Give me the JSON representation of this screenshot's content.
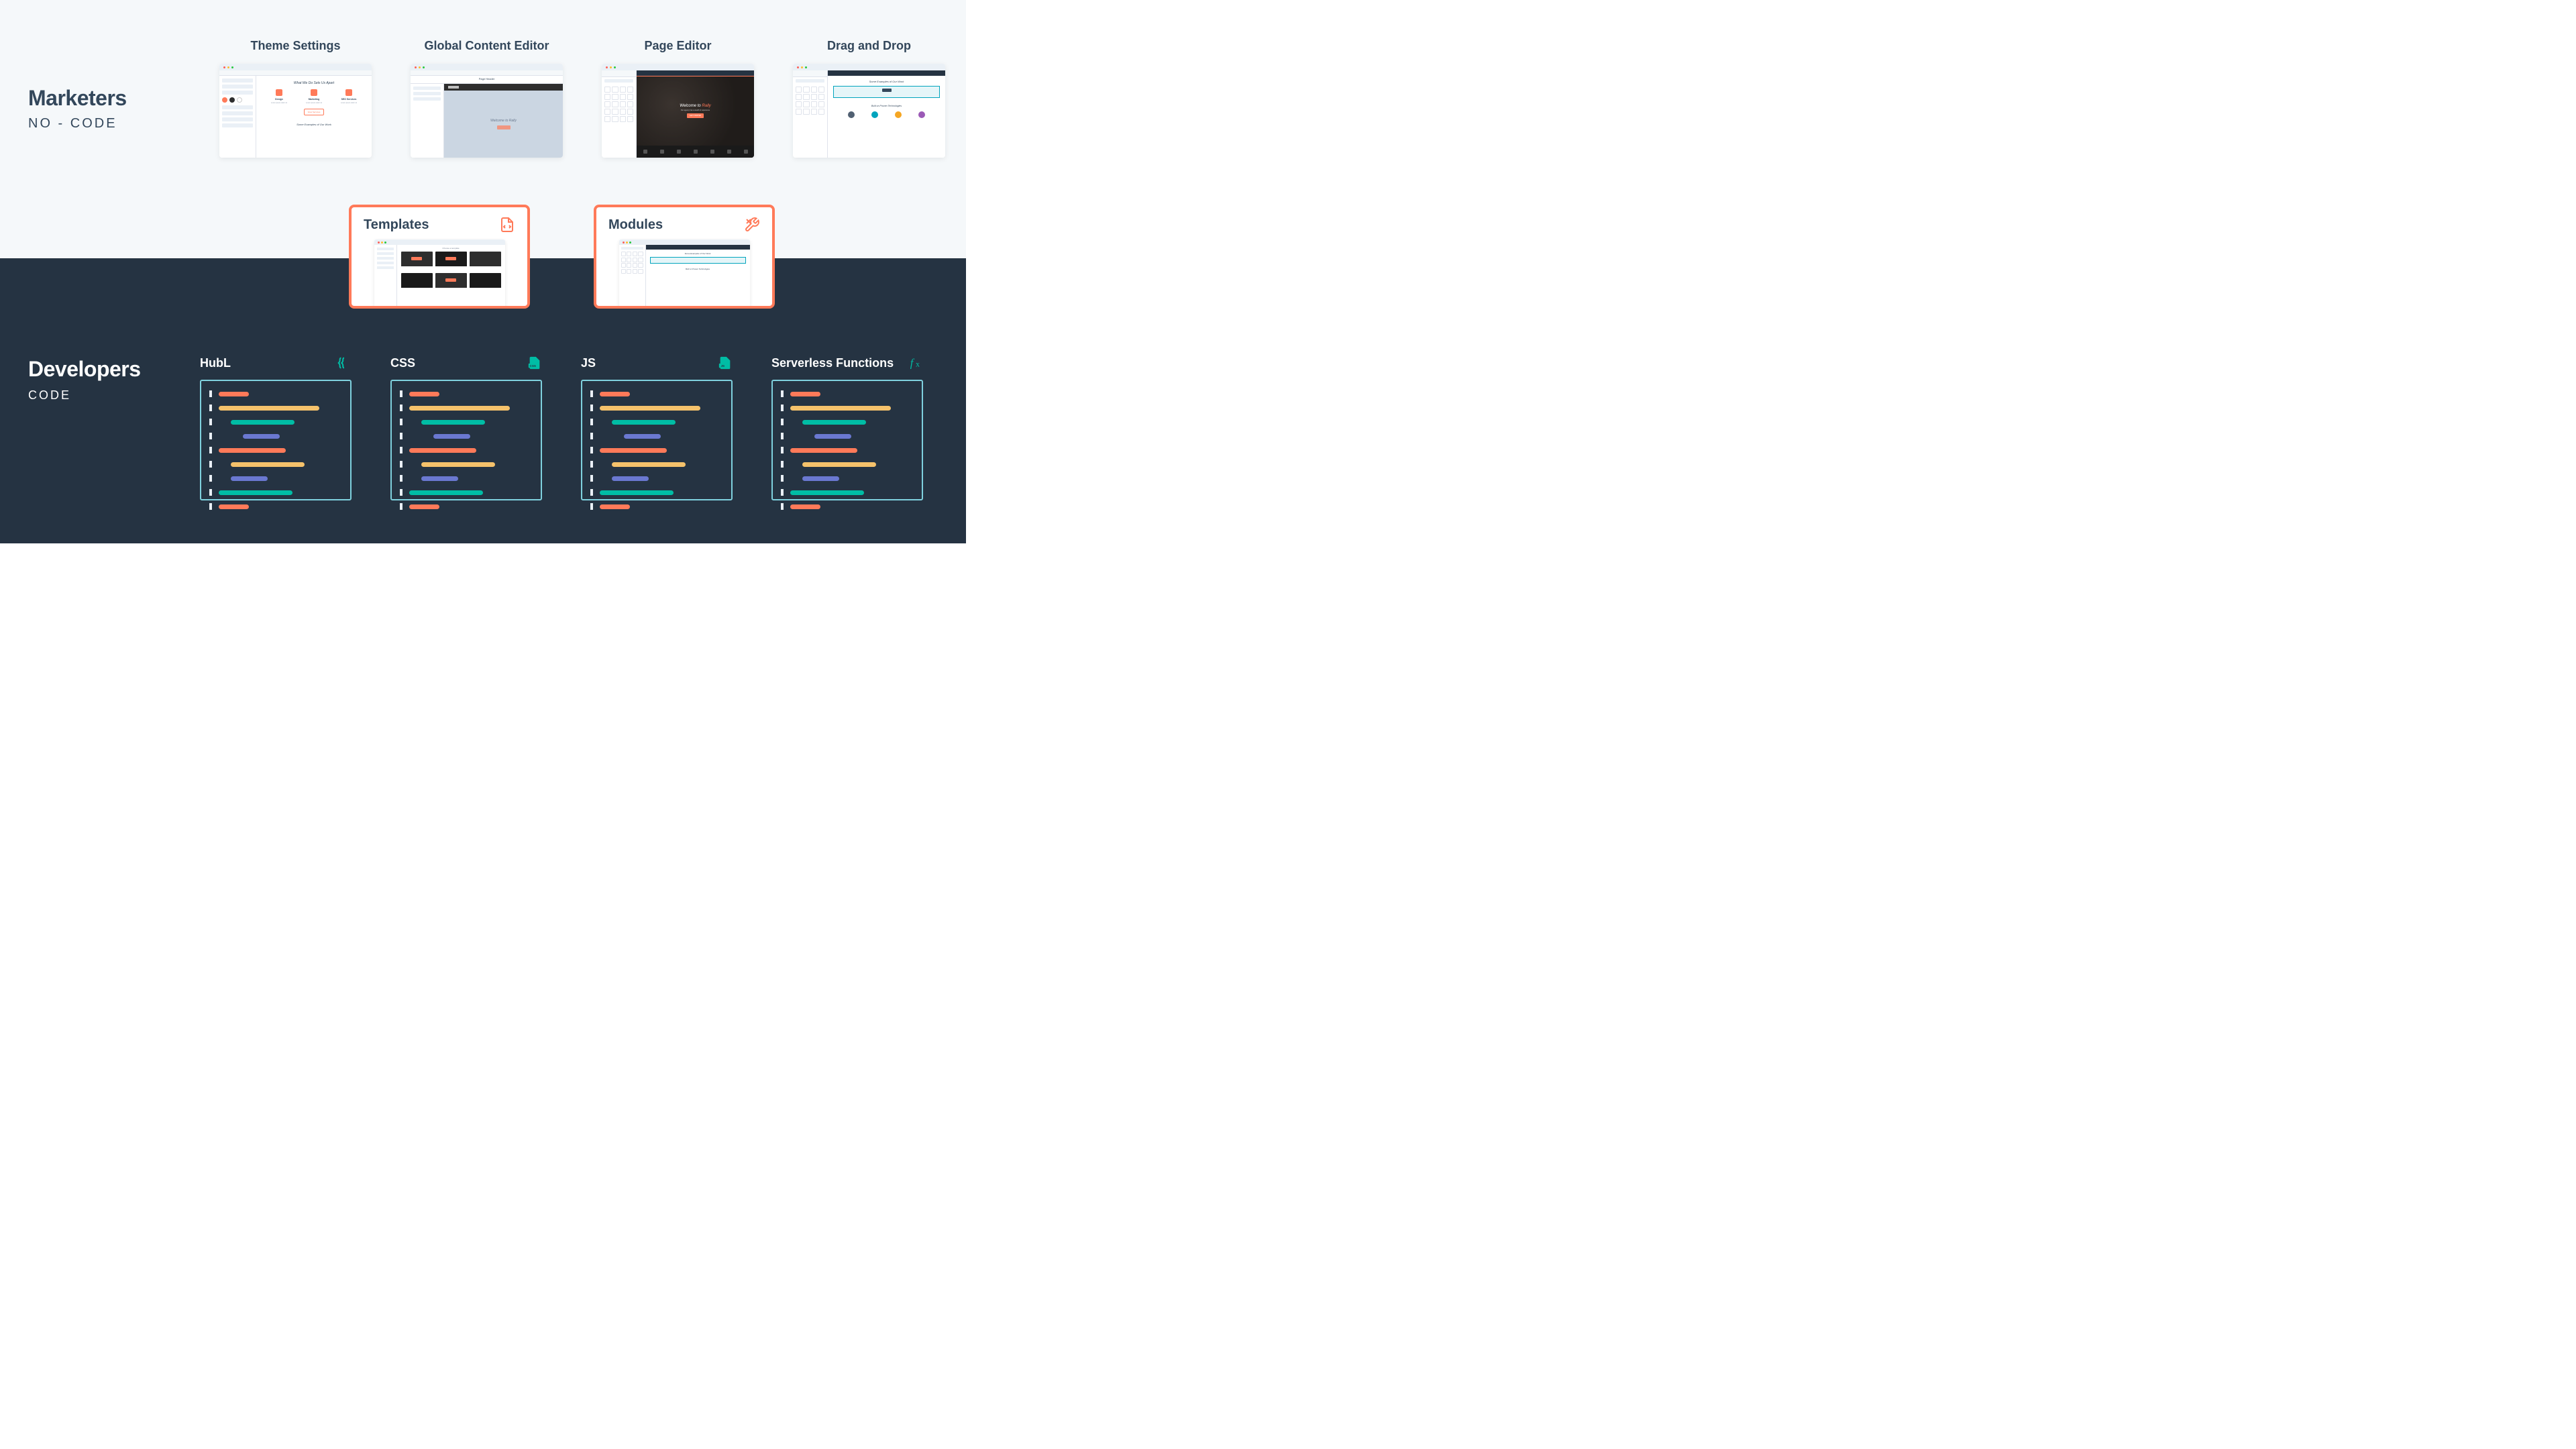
{
  "audiences": {
    "marketers": {
      "title": "Marketers",
      "subtitle": "NO - CODE"
    },
    "developers": {
      "title": "Developers",
      "subtitle": "CODE"
    }
  },
  "marketer_tools": {
    "theme_settings": {
      "label": "Theme Settings",
      "preview": {
        "hero_title": "What We Do Sets Us Apart",
        "cols": [
          "Design",
          "Marketing",
          "SEO Services"
        ],
        "cta": "View Services",
        "sub": "Some Examples of Our Work",
        "swatch_colors": [
          "#ff7a59",
          "#2e2e2e",
          "#fff"
        ]
      }
    },
    "global_content": {
      "label": "Global Content Editor",
      "preview": {
        "page": "Page Header",
        "brand": "Rally",
        "hero": "Welcome to Rally"
      }
    },
    "page_editor": {
      "label": "Page Editor",
      "preview": {
        "welcome_prefix": "Welcome to ",
        "welcome_brand": "Rally",
        "cta": "GET STARTED"
      }
    },
    "drag_drop": {
      "label": "Drag and Drop",
      "preview": {
        "title": "Some Examples of Our Work",
        "sub": "Built on Proven Technologies",
        "logo_colors": [
          "#516072",
          "#00a4bd",
          "#f5a623",
          "#9b59b6"
        ]
      }
    }
  },
  "bridge": {
    "templates": {
      "label": "Templates",
      "preview": {
        "header": "Choose a template"
      }
    },
    "modules": {
      "label": "Modules",
      "preview": {
        "title": "Some Examples of Our Work",
        "sub": "Built on Proven Technologies"
      }
    }
  },
  "dev_tools": {
    "hubl": {
      "label": "HubL",
      "icon": "double-brace-icon"
    },
    "css": {
      "label": "CSS",
      "icon": "css-file-icon"
    },
    "js": {
      "label": "JS",
      "icon": "js-file-icon"
    },
    "serverless": {
      "label": "Serverless Functions",
      "icon": "fx-function-icon"
    }
  },
  "code_lines": [
    {
      "indent": 0,
      "color": "c-orange",
      "width": 45
    },
    {
      "indent": 0,
      "color": "c-yellow",
      "width": 150
    },
    {
      "indent": 1,
      "color": "c-teal",
      "width": 95
    },
    {
      "indent": 2,
      "color": "c-purple",
      "width": 55
    },
    {
      "indent": 0,
      "color": "c-orange",
      "width": 100
    },
    {
      "indent": 1,
      "color": "c-yellow",
      "width": 110
    },
    {
      "indent": 1,
      "color": "c-purple",
      "width": 55
    },
    {
      "indent": 0,
      "color": "c-teal",
      "width": 110
    },
    {
      "indent": 0,
      "color": "c-orange",
      "width": 45
    }
  ],
  "colors": {
    "accent_orange": "#ff7a59",
    "accent_teal": "#00bda5",
    "dark_bg": "#253342",
    "light_bg": "#f5f8fa",
    "text_dark": "#33475b"
  }
}
